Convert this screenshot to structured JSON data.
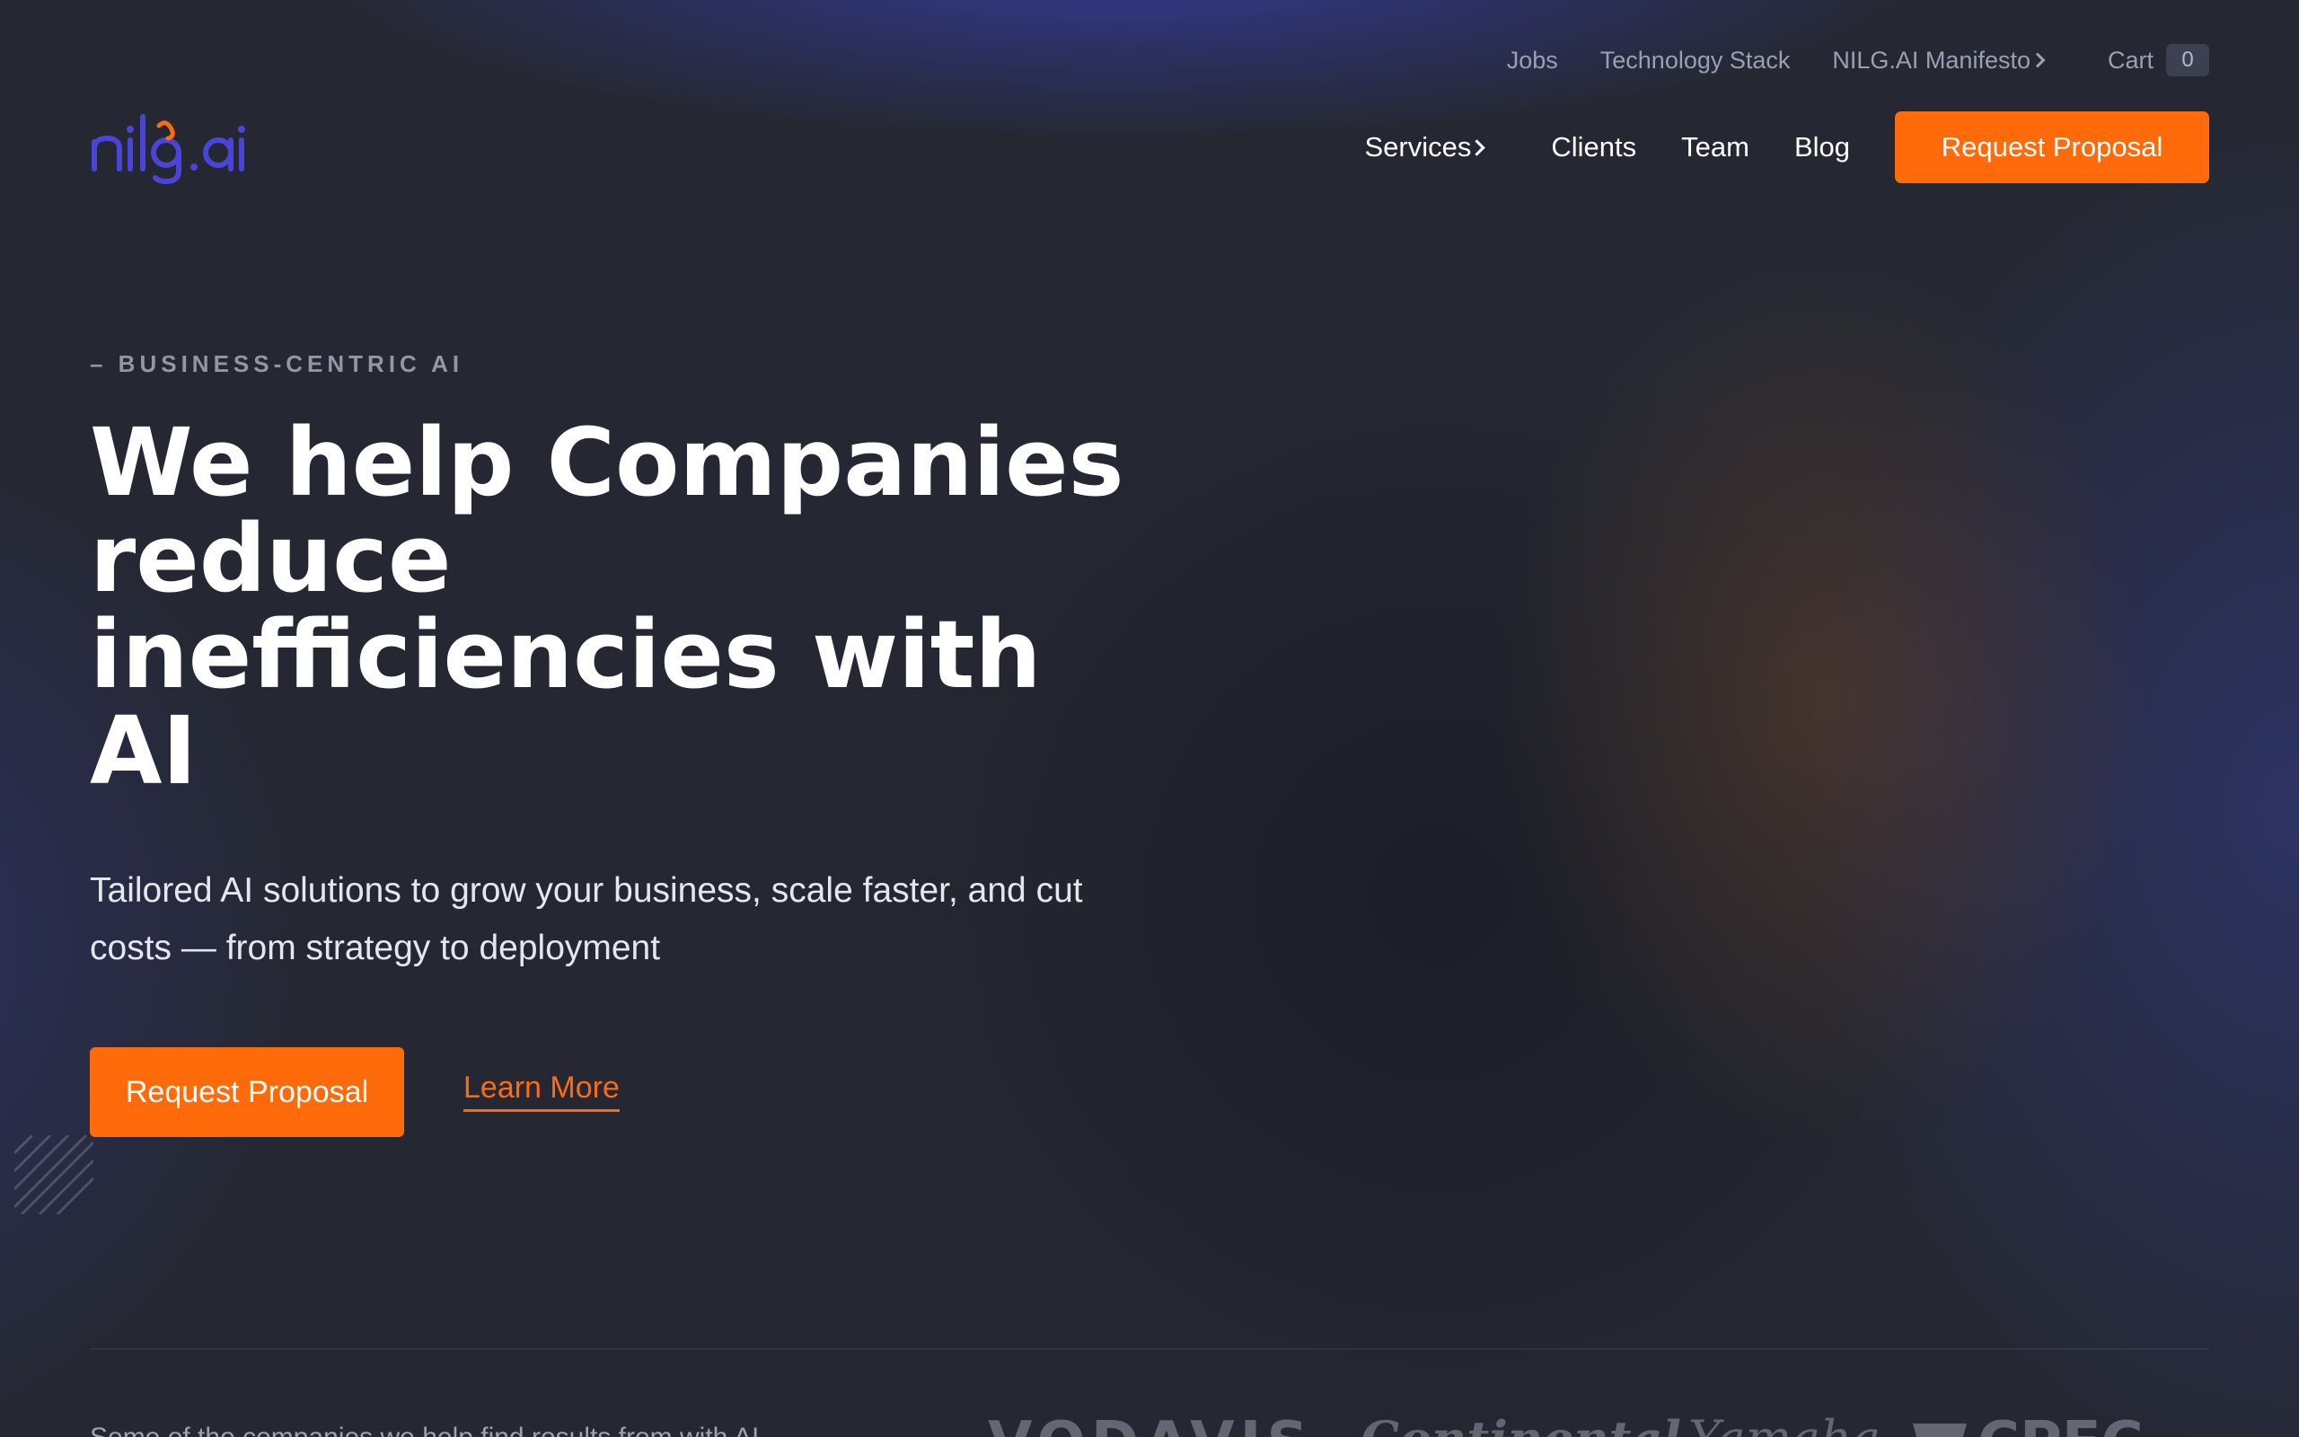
{
  "brand": {
    "logo_text": "nilg.ai",
    "colors": {
      "accent": "#ff6b0a",
      "logo": "#4a45d8",
      "background": "#252832"
    }
  },
  "utility_nav": {
    "items": [
      "Jobs",
      "Technology Stack",
      "NILG.AI Manifesto"
    ],
    "cart_label": "Cart",
    "cart_count": "0"
  },
  "main_nav": {
    "items": [
      "Services",
      "Clients",
      "Team",
      "Blog"
    ],
    "cta_label": "Request Proposal"
  },
  "hero": {
    "eyebrow": "– BUSINESS-CENTRIC AI",
    "headline": "We help Companies\nreduce\ninefficiencies with\nAI",
    "subhead": "Tailored AI solutions to grow your business, scale faster, and cut costs — from strategy to deployment",
    "primary_cta": "Request Proposal",
    "secondary_cta": "Learn More"
  },
  "clients": {
    "intro_text": "Some of the companies we help find results from with AI",
    "logos": [
      "VODAVIS",
      "Continental",
      "Yamaha",
      "CPEC"
    ]
  },
  "icons": [
    "chevron-right-icon",
    "diagonal-stripes-decoration"
  ]
}
